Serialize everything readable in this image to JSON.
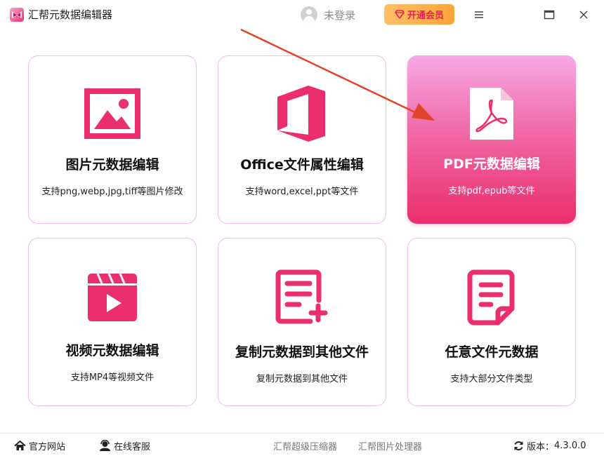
{
  "app": {
    "title": "汇帮元数据编辑器",
    "login_text": "未登录",
    "vip_label": "开通会员"
  },
  "cards": [
    {
      "title": "图片元数据编辑",
      "subtitle": "支持png,webp,jpg,tiff等图片修改",
      "icon": "image-icon"
    },
    {
      "title": "Office文件属性编辑",
      "subtitle": "支持word,excel,ppt等文件",
      "icon": "office-icon"
    },
    {
      "title": "PDF元数据编辑",
      "subtitle": "支持pdf,epub等文件",
      "icon": "pdf-icon",
      "active": true
    },
    {
      "title": "视频元数据编辑",
      "subtitle": "支持MP4等视频文件",
      "icon": "video-icon"
    },
    {
      "title": "复制元数据到其他文件",
      "subtitle": "复制元数据到其他文件",
      "icon": "copy-document-icon"
    },
    {
      "title": "任意文件元数据",
      "subtitle": "支持大部分文件类型",
      "icon": "document-icon"
    }
  ],
  "footer": {
    "website": "官方网站",
    "support": "在线客服",
    "link1": "汇帮超级压缩器",
    "link2": "汇帮图片处理器",
    "version_label": "版本：",
    "version": "4.3.0.0"
  },
  "colors": {
    "accent": "#eb2e6d",
    "card_border": "#f4b8f3",
    "vip_bg": "#f9a43a",
    "arrow": "#e0452a"
  }
}
